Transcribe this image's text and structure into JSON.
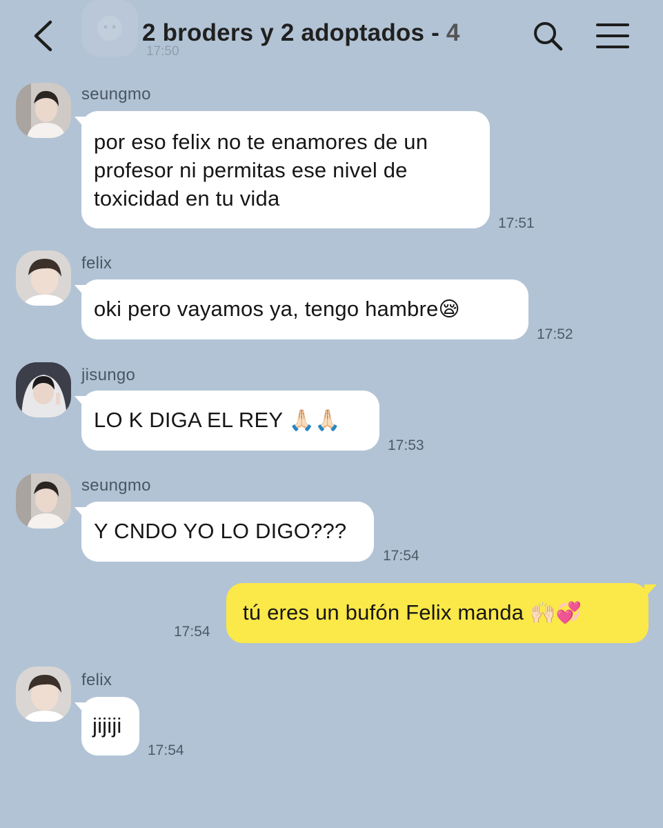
{
  "header": {
    "back_icon": "chevron-left-icon",
    "title": "2 broders y 2 adoptados -",
    "member_count": "4",
    "ghost_time": "17:50",
    "search_icon": "search-icon",
    "menu_icon": "hamburger-menu-icon"
  },
  "colors": {
    "background": "#b2c3d5",
    "bubble_other": "#ffffff",
    "bubble_mine": "#fbe849"
  },
  "messages": [
    {
      "sender": "seungmo",
      "text": "por eso felix no te enamores de un profesor ni permitas ese nivel de toxicidad en tu vida",
      "time": "17:51"
    },
    {
      "sender": "felix",
      "text": "oki pero vayamos ya, tengo hambre",
      "emoji": "😪",
      "time": "17:52"
    },
    {
      "sender": "jisungo",
      "text": "LO K DIGA EL REY",
      "emoji": "🙏🏻🙏🏻",
      "time": "17:53"
    },
    {
      "sender": "seungmo",
      "text": "Y CNDO YO LO DIGO???",
      "time": "17:54"
    },
    {
      "sender": "",
      "text": "tú eres un bufón Felix manda",
      "emoji": "🙌🏻💞",
      "time": "17:54"
    },
    {
      "sender": "felix",
      "text": "jijiji",
      "time": "17:54"
    }
  ]
}
